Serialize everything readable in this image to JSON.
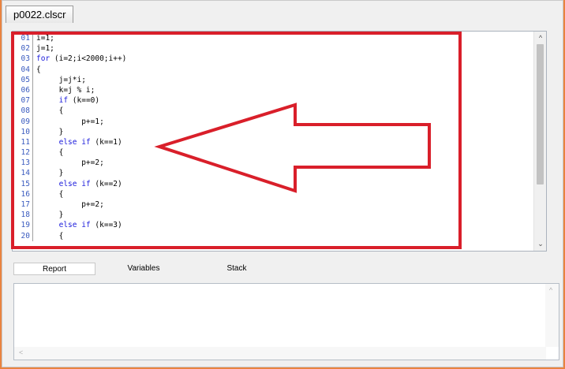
{
  "document_tab": {
    "label": "p0022.clscr"
  },
  "editor": {
    "lines": [
      {
        "num": "01",
        "code": "i=1;"
      },
      {
        "num": "02",
        "code": "j=1;"
      },
      {
        "num": "03",
        "code": "for (i=2;i<2000;i++)"
      },
      {
        "num": "04",
        "code": "{"
      },
      {
        "num": "05",
        "code": "     j=j*i;"
      },
      {
        "num": "06",
        "code": "     k=j % i;"
      },
      {
        "num": "07",
        "code": "     if (k==0)"
      },
      {
        "num": "08",
        "code": "     {"
      },
      {
        "num": "09",
        "code": "          p+=1;"
      },
      {
        "num": "10",
        "code": "     }"
      },
      {
        "num": "11",
        "code": "     else if (k==1)"
      },
      {
        "num": "12",
        "code": "     {"
      },
      {
        "num": "13",
        "code": "          p+=2;"
      },
      {
        "num": "14",
        "code": "     }"
      },
      {
        "num": "15",
        "code": "     else if (k==2)"
      },
      {
        "num": "16",
        "code": "     {"
      },
      {
        "num": "17",
        "code": "          p+=2;"
      },
      {
        "num": "18",
        "code": "     }"
      },
      {
        "num": "19",
        "code": "     else if (k==3)"
      },
      {
        "num": "20",
        "code": "     {"
      }
    ]
  },
  "bottom_tabs": [
    {
      "label": "Report",
      "active": true
    },
    {
      "label": "Variables",
      "active": false
    },
    {
      "label": "Stack",
      "active": false
    }
  ],
  "colors": {
    "highlight": "#d91f2a",
    "keyword": "#1a1adb",
    "background": "#e9833f"
  },
  "icons": {
    "scroll_up": "chevron-up-icon",
    "scroll_down": "chevron-down-icon",
    "scroll_left": "chevron-left-icon",
    "scroll_right": "chevron-right-icon"
  }
}
